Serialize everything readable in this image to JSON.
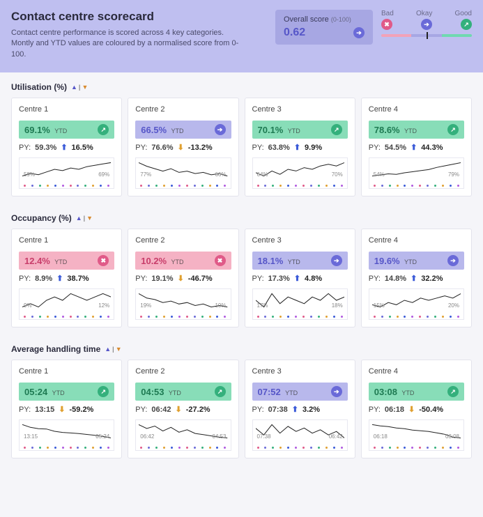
{
  "header": {
    "title": "Contact centre scorecard",
    "desc": "Contact centre performance is scored across 4 key categories. Montly and YTD values are coloured by a normalised score from 0-100.",
    "overall_label": "Overall score",
    "overall_range": "(0-100)",
    "overall_value": "0.62",
    "legend": {
      "bad": "Bad",
      "okay": "Okay",
      "good": "Good"
    }
  },
  "colors": {
    "good": "#34b07c",
    "okay": "#6a6ad8",
    "bad": "#e05a88",
    "arrow_up": "#3a5ad8",
    "arrow_down": "#e0a030"
  },
  "dot_palette": [
    "#e05a88",
    "#6a6ad8",
    "#34b07c",
    "#e0a030",
    "#3a5ad8",
    "#b05ae0",
    "#e05a88",
    "#6a6ad8",
    "#34b07c",
    "#e0a030",
    "#3a5ad8",
    "#b05ae0"
  ],
  "sections": [
    {
      "id": "utilisation",
      "title": "Utilisation (%)",
      "cards": [
        {
          "name": "Centre 1",
          "value": "69.1%",
          "band": "good",
          "py": "59.3%",
          "change": "16.5%",
          "dir": "up",
          "spark_left": "59%",
          "spark_right": "69%"
        },
        {
          "name": "Centre 2",
          "value": "66.5%",
          "band": "okay",
          "py": "76.6%",
          "change": "-13.2%",
          "dir": "down",
          "spark_left": "77%",
          "spark_right": "66%"
        },
        {
          "name": "Centre 3",
          "value": "70.1%",
          "band": "good",
          "py": "63.8%",
          "change": "9.9%",
          "dir": "up",
          "spark_left": "64%",
          "spark_right": "70%"
        },
        {
          "name": "Centre 4",
          "value": "78.6%",
          "band": "good",
          "py": "54.5%",
          "change": "44.3%",
          "dir": "up",
          "spark_left": "54%",
          "spark_right": "79%"
        }
      ]
    },
    {
      "id": "occupancy",
      "title": "Occupancy (%)",
      "cards": [
        {
          "name": "Centre 1",
          "value": "12.4%",
          "band": "bad",
          "py": "8.9%",
          "change": "38.7%",
          "dir": "up",
          "spark_left": "9%",
          "spark_right": "12%"
        },
        {
          "name": "Centre 2",
          "value": "10.2%",
          "band": "bad",
          "py": "19.1%",
          "change": "-46.7%",
          "dir": "down",
          "spark_left": "19%",
          "spark_right": "10%"
        },
        {
          "name": "Centre 3",
          "value": "18.1%",
          "band": "okay",
          "py": "17.3%",
          "change": "4.8%",
          "dir": "up",
          "spark_left": "17%",
          "spark_right": "18%"
        },
        {
          "name": "Centre 4",
          "value": "19.6%",
          "band": "okay",
          "py": "14.8%",
          "change": "32.2%",
          "dir": "up",
          "spark_left": "15%",
          "spark_right": "20%"
        }
      ]
    },
    {
      "id": "aht",
      "title": "Average handling time",
      "cards": [
        {
          "name": "Centre 1",
          "value": "05:24",
          "band": "good",
          "py": "13:15",
          "change": "-59.2%",
          "dir": "down",
          "spark_left": "13:15",
          "spark_right": "05:24"
        },
        {
          "name": "Centre 2",
          "value": "04:53",
          "band": "good",
          "py": "06:42",
          "change": "-27.2%",
          "dir": "down",
          "spark_left": "06:42",
          "spark_right": "04:53"
        },
        {
          "name": "Centre 3",
          "value": "07:52",
          "band": "okay",
          "py": "07:38",
          "change": "3.2%",
          "dir": "up",
          "spark_left": "07:38",
          "spark_right": "06:42"
        },
        {
          "name": "Centre 4",
          "value": "03:08",
          "band": "good",
          "py": "06:18",
          "change": "-50.4%",
          "dir": "down",
          "spark_left": "06:18",
          "spark_right": "03:08"
        }
      ]
    }
  ],
  "labels": {
    "ytd": "YTD",
    "py": "PY:"
  },
  "chart_data": {
    "type": "table",
    "title": "Contact centre scorecard",
    "overall_score": 0.62,
    "scale": {
      "min": 0,
      "max": 100,
      "bands": [
        "Bad",
        "Okay",
        "Good"
      ]
    },
    "metrics": [
      {
        "metric": "Utilisation (%)",
        "unit": "%",
        "centres": [
          {
            "name": "Centre 1",
            "ytd": 69.1,
            "py": 59.3,
            "change_pct": 16.5,
            "band": "good"
          },
          {
            "name": "Centre 2",
            "ytd": 66.5,
            "py": 76.6,
            "change_pct": -13.2,
            "band": "okay"
          },
          {
            "name": "Centre 3",
            "ytd": 70.1,
            "py": 63.8,
            "change_pct": 9.9,
            "band": "good"
          },
          {
            "name": "Centre 4",
            "ytd": 78.6,
            "py": 54.5,
            "change_pct": 44.3,
            "band": "good"
          }
        ]
      },
      {
        "metric": "Occupancy (%)",
        "unit": "%",
        "centres": [
          {
            "name": "Centre 1",
            "ytd": 12.4,
            "py": 8.9,
            "change_pct": 38.7,
            "band": "bad"
          },
          {
            "name": "Centre 2",
            "ytd": 10.2,
            "py": 19.1,
            "change_pct": -46.7,
            "band": "bad"
          },
          {
            "name": "Centre 3",
            "ytd": 18.1,
            "py": 17.3,
            "change_pct": 4.8,
            "band": "okay"
          },
          {
            "name": "Centre 4",
            "ytd": 19.6,
            "py": 14.8,
            "change_pct": 32.2,
            "band": "okay"
          }
        ]
      },
      {
        "metric": "Average handling time",
        "unit": "mm:ss",
        "centres": [
          {
            "name": "Centre 1",
            "ytd": "05:24",
            "py": "13:15",
            "change_pct": -59.2,
            "band": "good"
          },
          {
            "name": "Centre 2",
            "ytd": "04:53",
            "py": "06:42",
            "change_pct": -27.2,
            "band": "good"
          },
          {
            "name": "Centre 3",
            "ytd": "07:52",
            "py": "07:38",
            "change_pct": 3.2,
            "band": "okay"
          },
          {
            "name": "Centre 4",
            "ytd": "03:08",
            "py": "06:18",
            "change_pct": -50.4,
            "band": "good"
          }
        ]
      }
    ],
    "sparklines": {
      "utilisation": {
        "Centre 1": [
          59,
          61,
          60,
          62,
          64,
          63,
          65,
          64,
          66,
          67,
          68,
          69
        ],
        "Centre 2": [
          77,
          74,
          72,
          70,
          72,
          69,
          70,
          68,
          69,
          67,
          68,
          66
        ],
        "Centre 3": [
          64,
          62,
          65,
          63,
          66,
          65,
          67,
          66,
          68,
          69,
          68,
          70
        ],
        "Centre 4": [
          54,
          56,
          58,
          57,
          60,
          62,
          64,
          66,
          70,
          73,
          76,
          79
        ]
      },
      "occupancy": {
        "Centre 1": [
          9,
          10,
          9,
          11,
          12,
          11,
          13,
          12,
          11,
          12,
          13,
          12
        ],
        "Centre 2": [
          19,
          16,
          15,
          13,
          14,
          12,
          13,
          11,
          12,
          10,
          11,
          10
        ],
        "Centre 3": [
          17,
          15,
          19,
          16,
          18,
          17,
          16,
          18,
          17,
          19,
          17,
          18
        ],
        "Centre 4": [
          15,
          14,
          16,
          15,
          17,
          16,
          18,
          17,
          18,
          19,
          18,
          20
        ]
      },
      "aht": {
        "Centre 1": [
          795,
          700,
          650,
          640,
          560,
          520,
          500,
          480,
          450,
          420,
          380,
          324
        ],
        "Centre 2": [
          402,
          370,
          390,
          350,
          380,
          340,
          360,
          330,
          320,
          310,
          300,
          293
        ],
        "Centre 3": [
          458,
          420,
          480,
          430,
          470,
          440,
          460,
          430,
          450,
          420,
          440,
          402
        ],
        "Centre 4": [
          378,
          360,
          350,
          330,
          320,
          300,
          290,
          280,
          260,
          240,
          200,
          188
        ]
      }
    }
  }
}
